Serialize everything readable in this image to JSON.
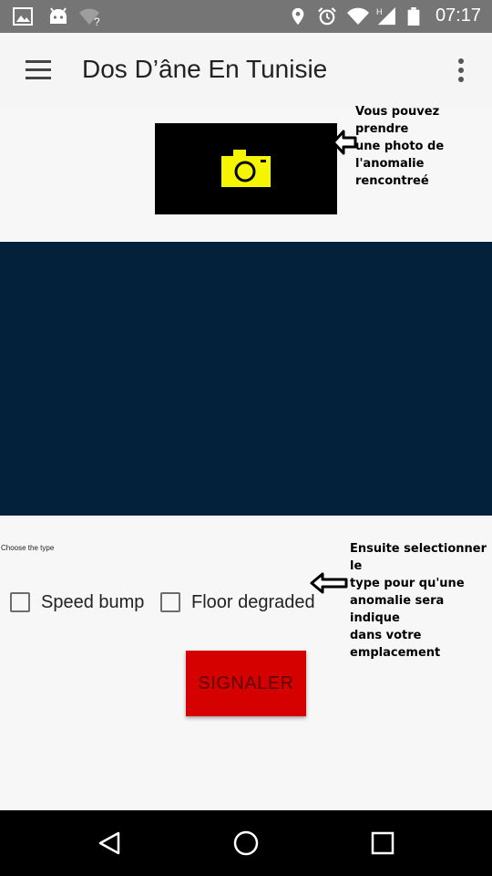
{
  "status_bar": {
    "time": "07:17",
    "icons": [
      "image-icon",
      "android-icon",
      "wifi-question-icon",
      "location-icon",
      "alarm-icon",
      "wifi-icon",
      "signal-h-icon",
      "battery-icon"
    ]
  },
  "app_bar": {
    "title": "Dos D’âne En Tunisie"
  },
  "camera_note": [
    "Vous pouvez prendre",
    "une photo de",
    "l'anomalie",
    "rencontreé"
  ],
  "type_section": {
    "label": "Choose the type",
    "options": [
      {
        "label": "Speed bump",
        "checked": false
      },
      {
        "label": "Floor degraded",
        "checked": false
      }
    ]
  },
  "type_note": [
    "Ensuite selectionner le",
    "type pour qu'une",
    "anomalie sera indique",
    "dans votre",
    "emplacement"
  ],
  "submit": {
    "label": "SIGNALER"
  },
  "colors": {
    "status_bar": "#757575",
    "map": "#03213a",
    "camera_icon": "#f5f500",
    "button": "#d50000"
  }
}
